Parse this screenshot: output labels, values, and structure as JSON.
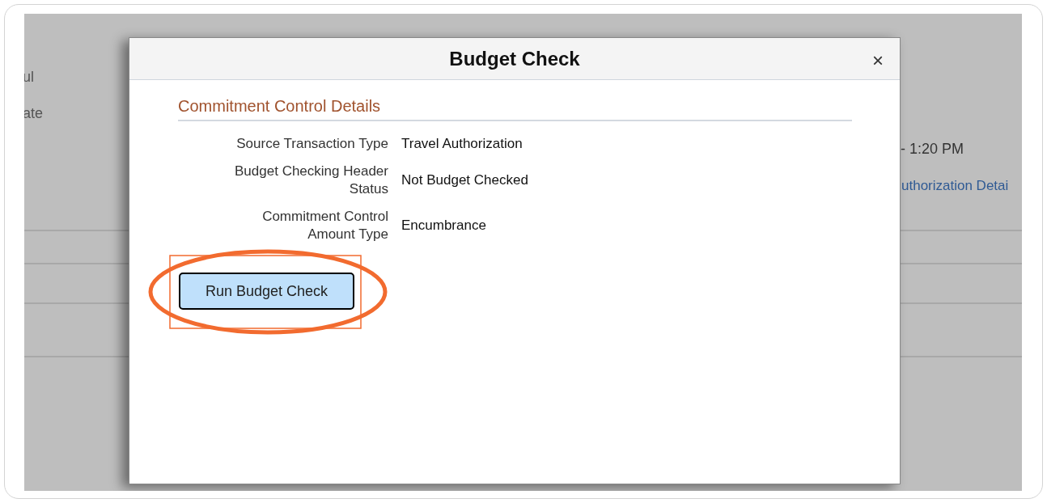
{
  "background_page": {
    "left_texts": [
      "ul",
      "ate"
    ],
    "time_text": "- 1:20 PM",
    "link": "uthorization Detai"
  },
  "dialog": {
    "title": "Budget Check",
    "close": "×",
    "section_title": "Commitment Control Details",
    "fields": [
      {
        "label": "Source Transaction Type",
        "value": "Travel Authorization"
      },
      {
        "label": "Budget Checking Header Status",
        "value": "Not Budget Checked"
      },
      {
        "label": "Commitment Control Amount Type",
        "value": "Encumbrance"
      }
    ],
    "button": {
      "label": "Run Budget Check",
      "highlighted": true
    }
  }
}
